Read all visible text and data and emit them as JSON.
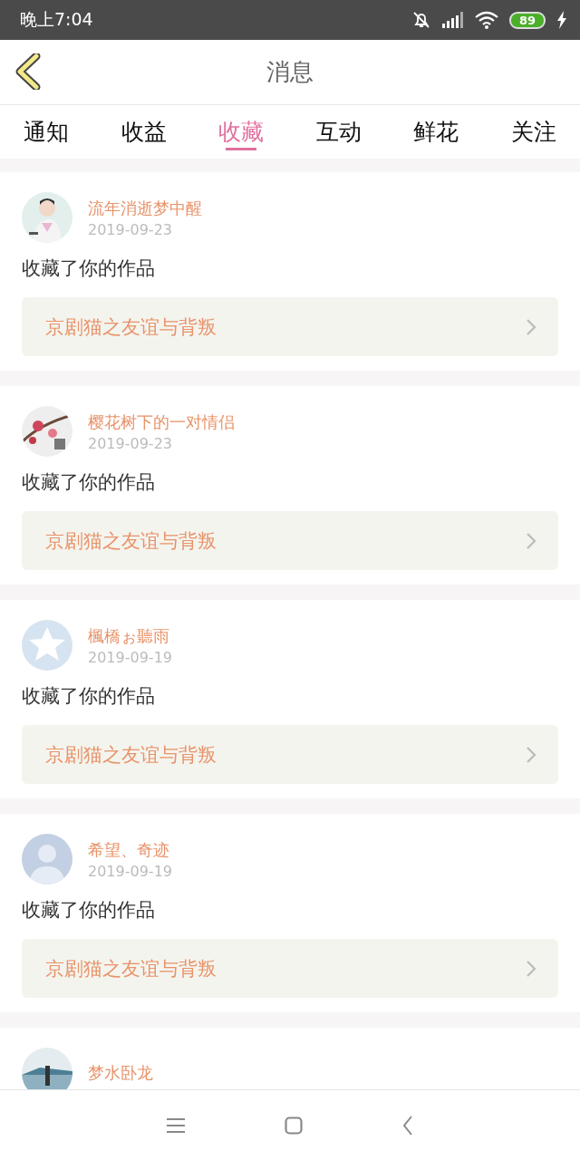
{
  "status_bar": {
    "time": "晚上7:04",
    "battery": "89"
  },
  "header": {
    "title": "消息"
  },
  "tabs": [
    {
      "label": "通知",
      "selected": false
    },
    {
      "label": "收益",
      "selected": false
    },
    {
      "label": "收藏",
      "selected": true
    },
    {
      "label": "互动",
      "selected": false
    },
    {
      "label": "鲜花",
      "selected": false
    },
    {
      "label": "关注",
      "selected": false
    }
  ],
  "messages": [
    {
      "name": "流年消逝梦中醒",
      "date": "2019-09-23",
      "text": "收藏了你的作品",
      "work": "京剧猫之友谊与背叛"
    },
    {
      "name": "樱花树下的一对情侣",
      "date": "2019-09-23",
      "text": "收藏了你的作品",
      "work": "京剧猫之友谊与背叛"
    },
    {
      "avatar": {
        "kind": "star"
      },
      "name": "楓橋ぉ聽雨",
      "date": "2019-09-19",
      "text": "收藏了你的作品",
      "work": "京剧猫之友谊与背叛"
    },
    {
      "avatar": {
        "kind": "person"
      },
      "name": "希望、奇迹",
      "date": "2019-09-19",
      "text": "收藏了你的作品",
      "work": "京剧猫之友谊与背叛"
    },
    {
      "name": "梦水卧龙"
    }
  ]
}
